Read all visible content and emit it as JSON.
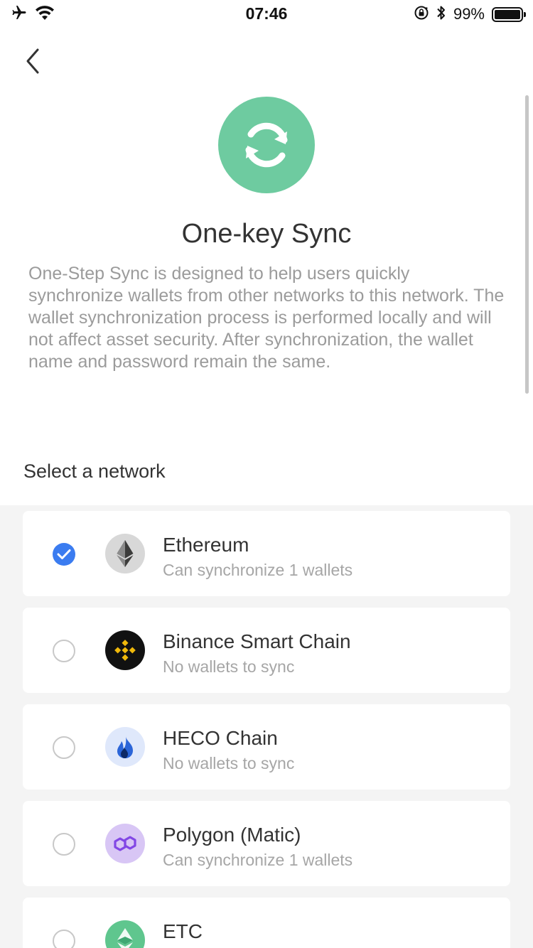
{
  "status_bar": {
    "time": "07:46",
    "battery_text": "99%",
    "battery_level": 0.99,
    "icons": [
      "airplane-icon",
      "wifi-icon",
      "orientation-lock-icon",
      "bluetooth-icon",
      "battery-icon"
    ]
  },
  "header": {
    "back_icon": "chevron-left-icon",
    "logo_icon": "sync-icon",
    "title": "One-key Sync",
    "description": "One-Step Sync is designed to help users quickly synchronize wallets from other networks to this network. The wallet synchronization process is performed locally and will not affect asset security. After synchronization, the wallet name and password remain the same."
  },
  "section": {
    "label": "Select a network"
  },
  "networks": [
    {
      "name": "Ethereum",
      "status": "Can synchronize 1 wallets",
      "selected": true,
      "icon": "ethereum-icon",
      "color": "#d8d8d8"
    },
    {
      "name": "Binance Smart Chain",
      "status": "No wallets to sync",
      "selected": false,
      "icon": "binance-icon",
      "color": "#111111"
    },
    {
      "name": "HECO Chain",
      "status": "No wallets to sync",
      "selected": false,
      "icon": "heco-icon",
      "color": "#dfe8fb"
    },
    {
      "name": "Polygon (Matic)",
      "status": "Can synchronize 1 wallets",
      "selected": false,
      "icon": "polygon-icon",
      "color": "#d8c6f5"
    },
    {
      "name": "ETC",
      "status": "",
      "selected": false,
      "icon": "etc-icon",
      "color": "#5fc68e"
    }
  ],
  "colors": {
    "accent": "#3b7cf0",
    "sync_green": "#6ecba0",
    "muted_text": "#9b9b9b",
    "list_bg": "#f4f4f4"
  }
}
